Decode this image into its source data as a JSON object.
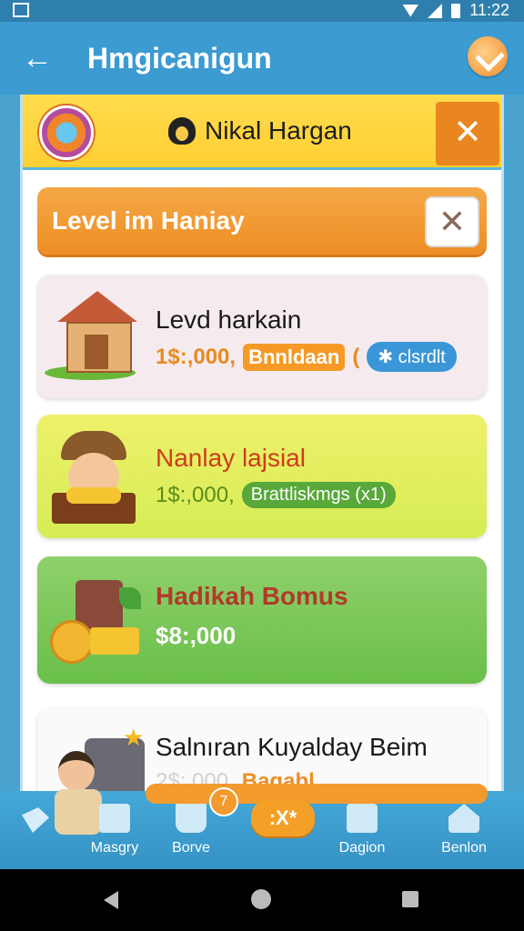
{
  "status_bar": {
    "time": "11:22"
  },
  "app_bar": {
    "title": "Hmgicanigun",
    "back_icon": "arrow-left-icon",
    "logo_icon": "app-logo-icon"
  },
  "dialog": {
    "title": "Nikal Hargan",
    "close_label": "✕",
    "level_title": "Level im Haniay",
    "level_close_label": "✕"
  },
  "cards": [
    {
      "title": "Levd harkain",
      "price": "1$:,000,",
      "tag": "Bnnldaan",
      "sep": "(",
      "chip": "✱ clsrdlt"
    },
    {
      "title": "Nanlay lajsial",
      "price": "1$:,000,",
      "chip": "Brattliskmgs (x1)"
    },
    {
      "title": "Hadikah Bomus",
      "price": "$8:,000"
    },
    {
      "title": "Salnıran Kuyalday Beim",
      "price": "2$:,000,",
      "tag": "Bagabl"
    }
  ],
  "bottom_nav": {
    "items": [
      {
        "label": "Masgry",
        "icon": "basket-icon"
      },
      {
        "label": "Borve",
        "icon": "cup-icon"
      },
      {
        "label": "Dagion",
        "icon": "notepad-icon"
      },
      {
        "label": "Benlon",
        "icon": "home-icon"
      }
    ],
    "center_label": ":X*",
    "badge": "7"
  },
  "colors": {
    "primary": "#3c9bd0",
    "accent": "#ee8e25",
    "header_yellow": "#ffd43a",
    "card_green": "#6abf4a",
    "card_lime": "#dcef5a"
  }
}
